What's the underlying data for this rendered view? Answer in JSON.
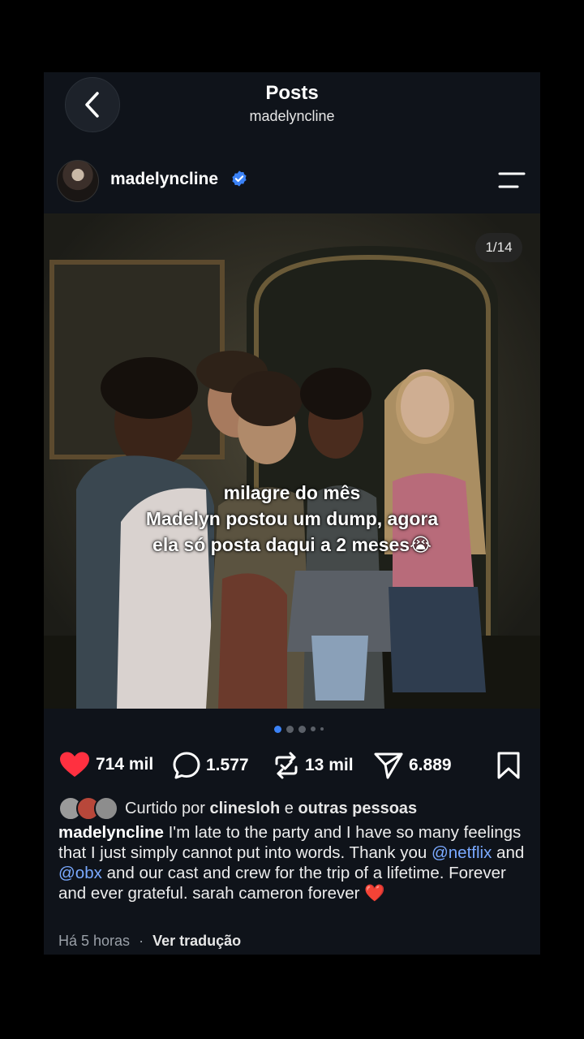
{
  "header": {
    "title": "Posts",
    "username": "madelyncline"
  },
  "post": {
    "author": "madelyncline",
    "verified": true,
    "media_counter": "1/14",
    "overlay_lines": [
      "milagre do mês",
      "Madelyn postou um dump, agora",
      "ela só posta daqui a 2 meses😭"
    ],
    "carousel_position": 1,
    "stats": {
      "likes": "714 mil",
      "comments": "1.577",
      "reposts": "13 mil",
      "shares": "6.889"
    },
    "liked_by": {
      "prefix": "Curtido por",
      "user": "clinesloh",
      "connector": "e",
      "others": "outras pessoas"
    },
    "caption": {
      "author": "madelyncline",
      "part1": "I'm late to the party and I have so many feelings that I just simply cannot put into words. Thank you ",
      "mention1": "@netflix",
      "part2": " and ",
      "mention2": "@obx",
      "part3": " and our cast and crew for the trip of a lifetime. Forever and ever grateful. sarah cameron forever ❤️"
    },
    "timestamp": "Há 5 horas",
    "separator": "·",
    "translate_label": "Ver tradução"
  },
  "colors": {
    "background": "#0f131a",
    "like": "#ff3040",
    "verified": "#3b82f6",
    "mention": "#7aa9ff"
  }
}
